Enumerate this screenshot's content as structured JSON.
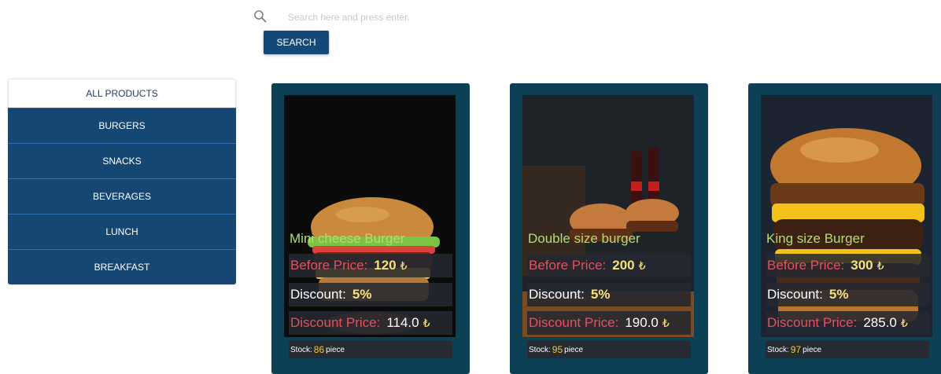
{
  "search": {
    "placeholder": "Search here and press enter.",
    "button_label": "SEARCH"
  },
  "categories": [
    {
      "label": "ALL PRODUCTS",
      "active": true
    },
    {
      "label": "BURGERS"
    },
    {
      "label": "SNACKS"
    },
    {
      "label": "BEVERAGES"
    },
    {
      "label": "LUNCH"
    },
    {
      "label": "BREAKFAST"
    }
  ],
  "labels": {
    "before_price": "Before Price:",
    "discount": "Discount:",
    "discount_price": "Discount Price:",
    "stock": "Stock:",
    "piece": "piece",
    "currency": "₺"
  },
  "products": [
    {
      "name": "Mini cheese Burger",
      "before_price": "120",
      "discount": "5%",
      "discount_price": "114.0",
      "stock": "86"
    },
    {
      "name": "Double size burger",
      "before_price": "200",
      "discount": "5%",
      "discount_price": "190.0",
      "stock": "95"
    },
    {
      "name": "King size Burger",
      "before_price": "300",
      "discount": "5%",
      "discount_price": "285.0",
      "stock": "97"
    }
  ],
  "colors": {
    "primary": "#164772",
    "card_bg": "#0d3f55",
    "price_red": "#e5505c",
    "value_yellow": "#f5e17a",
    "name_green": "#b7d97a"
  }
}
